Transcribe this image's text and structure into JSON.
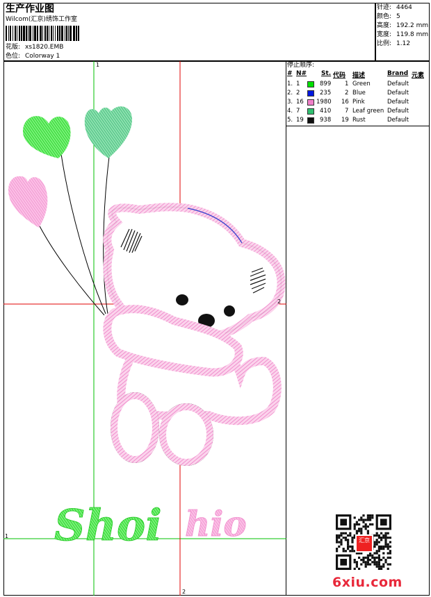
{
  "header": {
    "title": "生产作业图",
    "company": "Wilcom(汇京)绣饰工作室",
    "design_label": "花版:",
    "design_value": "xs1820.EMB",
    "colorway_label": "色位:",
    "colorway_value": "Colorway 1"
  },
  "stats": [
    {
      "label": "针迹:",
      "value": "4464"
    },
    {
      "label": "颜色:",
      "value": "5"
    },
    {
      "label": "高度:",
      "value": "192.2 mm"
    },
    {
      "label": "宽度:",
      "value": "119.8 mm"
    },
    {
      "label": "比例:",
      "value": "1.12"
    }
  ],
  "stop_sequence": {
    "title": "停止顺序:",
    "headers": [
      "#",
      "N#",
      "St.",
      "代码",
      "描述",
      "Brand",
      "元素"
    ],
    "rows": [
      {
        "num": "1.",
        "n": "1",
        "color": "#00e000",
        "st": "899",
        "code": "1",
        "desc": "Green",
        "brand": "Default"
      },
      {
        "num": "2.",
        "n": "2",
        "color": "#0018e0",
        "st": "235",
        "code": "2",
        "desc": "Blue",
        "brand": "Default"
      },
      {
        "num": "3.",
        "n": "16",
        "color": "#f080c8",
        "st": "1980",
        "code": "16",
        "desc": "Pink",
        "brand": "Default"
      },
      {
        "num": "4.",
        "n": "7",
        "color": "#30c070",
        "st": "410",
        "code": "7",
        "desc": "Leaf green",
        "brand": "Default"
      },
      {
        "num": "5.",
        "n": "19",
        "color": "#101010",
        "st": "938",
        "code": "19",
        "desc": "Rust",
        "brand": "Default"
      }
    ]
  },
  "guides": {
    "v1": "1",
    "h1": "1",
    "v2": "2",
    "h2": "2"
  },
  "embroidery_text": {
    "part1": "Shoi",
    "part2": "hio"
  },
  "colors": {
    "green": "#28e028",
    "pink": "#f08ccc",
    "leaf": "#40c080",
    "guide_green": "#00c000",
    "guide_red": "#e00000"
  },
  "watermark": "6xiu.com",
  "stamp": "汇京"
}
